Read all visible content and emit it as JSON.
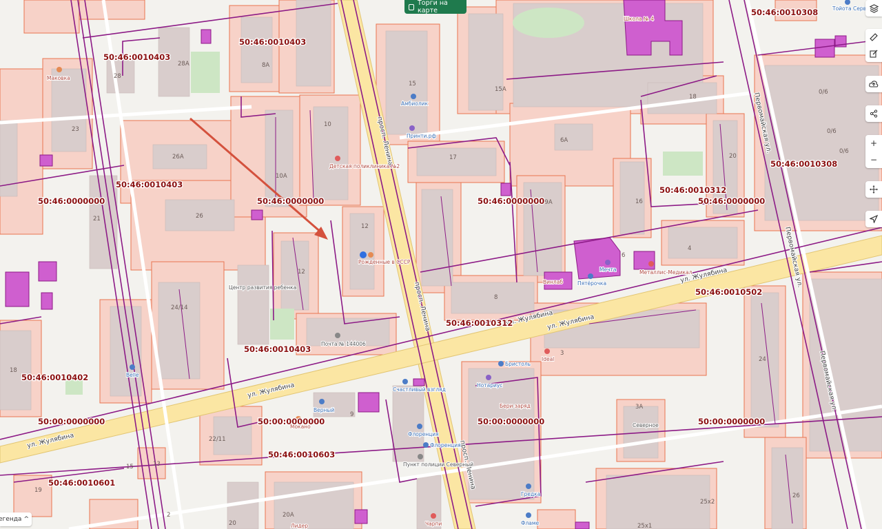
{
  "map": {
    "cadastral_labels": [
      "50:46:0010403",
      "50:46:0010403",
      "50:46:0010403",
      "50:46:0010403",
      "50:46:0000000",
      "50:46:0000000",
      "50:46:0000000",
      "50:46:0000000",
      "50:46:0010308",
      "50:46:0010308",
      "50:46:0010312",
      "50:46:0010312",
      "50:46:0010502",
      "50:46:0010402",
      "50:00:0000000",
      "50:00:0000000",
      "50:00:0000000",
      "50:00:0000000",
      "50:46:0010603",
      "50:46:0010601"
    ],
    "streets": [
      "просп. Ленина",
      "просп. Ленина",
      "просп. Ленина",
      "ул. Жулябина",
      "ул. Жулябина",
      "ул. Жулябина",
      "ул. Жулябина",
      "ул. Жулябина",
      "Первомайская ул.",
      "Первомайская ул.",
      "Первомайская ул."
    ],
    "house_numbers": [
      "28A",
      "28",
      "8А",
      "23",
      "26А",
      "26",
      "21",
      "10А",
      "10",
      "15",
      "15А",
      "6А",
      "17",
      "19А",
      "12",
      "12",
      "8",
      "4",
      "24/14",
      "18",
      "22/11",
      "15",
      "13",
      "19",
      "20",
      "2",
      "20А",
      "9",
      "3",
      "3А",
      "25х2",
      "25х1",
      "26",
      "24",
      "0/6",
      "0/6",
      "0/6",
      "20",
      "18",
      "6",
      "16"
    ],
    "pois": [
      {
        "name": "Маковка",
        "color": "red"
      },
      {
        "name": "Амбиолик",
        "color": "blue"
      },
      {
        "name": "Принти.рф",
        "color": "blue"
      },
      {
        "name": "Детская поликлиника №2",
        "color": "red"
      },
      {
        "name": "Рожденные в СССР",
        "color": "red"
      },
      {
        "name": "Школа № 4",
        "color": "red"
      },
      {
        "name": "Тойота Серви",
        "color": "blue"
      },
      {
        "name": "Центр развития ребенка",
        "color": "dark"
      },
      {
        "name": "Почта № 144006",
        "color": "dark"
      },
      {
        "name": "Belle",
        "color": "blue"
      },
      {
        "name": "Мечта",
        "color": "blue"
      },
      {
        "name": "Пятёрочка",
        "color": "blue"
      },
      {
        "name": "Винлаб",
        "color": "red"
      },
      {
        "name": "Металлис-Медикал",
        "color": "red"
      },
      {
        "name": "Бристоль",
        "color": "blue"
      },
      {
        "name": "Ideal",
        "color": "red"
      },
      {
        "name": "Нотариус",
        "color": "blue"
      },
      {
        "name": "Бери заряд",
        "color": "red"
      },
      {
        "name": "Счастливый взгляд",
        "color": "blue"
      },
      {
        "name": "Верный",
        "color": "blue"
      },
      {
        "name": "Мокано",
        "color": "red"
      },
      {
        "name": "Флоренция",
        "color": "blue"
      },
      {
        "name": "Флоренция",
        "color": "blue"
      },
      {
        "name": "Пункт полиции Северный",
        "color": "dark"
      },
      {
        "name": "Северное",
        "color": "dark"
      },
      {
        "name": "Гредка",
        "color": "blue"
      },
      {
        "name": "Фламе",
        "color": "blue"
      },
      {
        "name": "Чарпи",
        "color": "red"
      },
      {
        "name": "Лидер",
        "color": "red"
      }
    ],
    "colors": {
      "background": "#f3f2ee",
      "parcel_fill": "#f7d2c8",
      "parcel_stroke": "#e8744f",
      "boundary": "#8c1a86",
      "building": "#d9cdcc",
      "highlight": "#cf5fcf",
      "major_road": "#fbe6a3",
      "arrow": "#d4513d",
      "cadastral_text": "#8b1111"
    }
  },
  "toolbar": {
    "torgi_label": "Торги на карте",
    "layers_icon": "layers-icon",
    "ruler_icon": "ruler-icon",
    "edit_icon": "edit-icon",
    "upload_icon": "cloud-upload-icon",
    "share_icon": "share-icon",
    "zoom_in": "+",
    "zoom_out": "−",
    "move_icon": "move-icon",
    "locate_icon": "locate-icon"
  },
  "legend": {
    "label": "егенда"
  }
}
